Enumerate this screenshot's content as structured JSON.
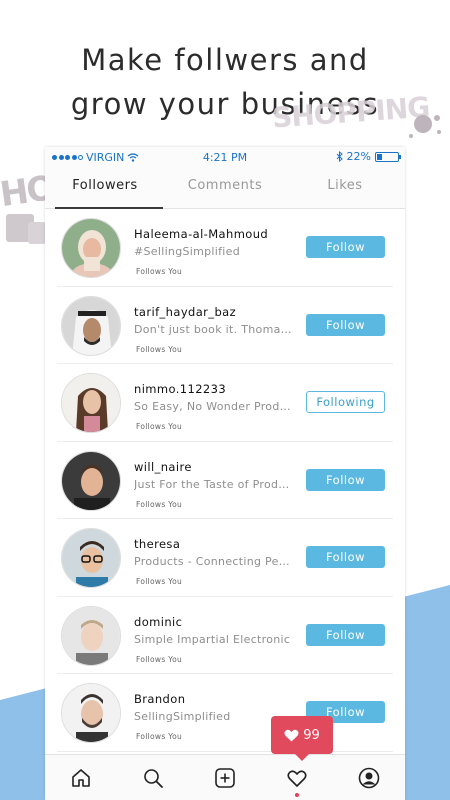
{
  "headline": {
    "line1": "Make follwers and",
    "line2": "grow your business"
  },
  "decor": {
    "shopping_text": "SHOPPING",
    "hop_text": "HOP"
  },
  "status_bar": {
    "carrier": "VIRGIN",
    "time": "4:21 PM",
    "battery_percent": "22%",
    "battery_level": 0.22,
    "signal_dots": 5,
    "signal_filled": 4
  },
  "tabs": [
    {
      "label": "Followers",
      "active": true
    },
    {
      "label": "Comments",
      "active": false
    },
    {
      "label": "Likes",
      "active": false
    }
  ],
  "followers": [
    {
      "username": "Haleema-al-Mahmoud",
      "bio": "#SellingSimplified",
      "sub": "Follows You",
      "button": "Follow",
      "state": "follow",
      "avatar": "avatar-woman-hijab"
    },
    {
      "username": "tarif_haydar_baz",
      "bio": "Don't just book it. Thomas...",
      "sub": "Follows You",
      "button": "Follow",
      "state": "follow",
      "avatar": "avatar-man-headdress"
    },
    {
      "username": "nimmo.112233",
      "bio": "So Easy, No Wonder Produ...",
      "sub": "Follows You",
      "button": "Following",
      "state": "following",
      "avatar": "avatar-woman-long-hair"
    },
    {
      "username": "will_naire",
      "bio": "Just For the Taste of Produ...",
      "sub": "Follows You",
      "button": "Follow",
      "state": "follow",
      "avatar": "avatar-man-smiling"
    },
    {
      "username": "theresa",
      "bio": "Products - Connecting People",
      "sub": "Follows You",
      "button": "Follow",
      "state": "follow",
      "avatar": "avatar-glasses"
    },
    {
      "username": "dominic",
      "bio": "Simple Impartial Electronic",
      "sub": "Follows You",
      "button": "Follow",
      "state": "follow",
      "avatar": "avatar-man-serious"
    },
    {
      "username": "Brandon",
      "bio": "SellingSimplified",
      "sub": "Follows You",
      "button": "Follow",
      "state": "follow",
      "avatar": "avatar-man-beard"
    }
  ],
  "badge": {
    "count": "99",
    "icon": "heart-icon"
  },
  "bottom_nav": [
    {
      "name": "home-icon"
    },
    {
      "name": "search-icon"
    },
    {
      "name": "add-post-icon"
    },
    {
      "name": "heart-icon"
    },
    {
      "name": "profile-icon"
    }
  ],
  "colors": {
    "accent": "#5bb9e1",
    "status_blue": "#1a73c9",
    "badge_red": "#e14a5c",
    "background_blue": "#8fc0ea"
  }
}
